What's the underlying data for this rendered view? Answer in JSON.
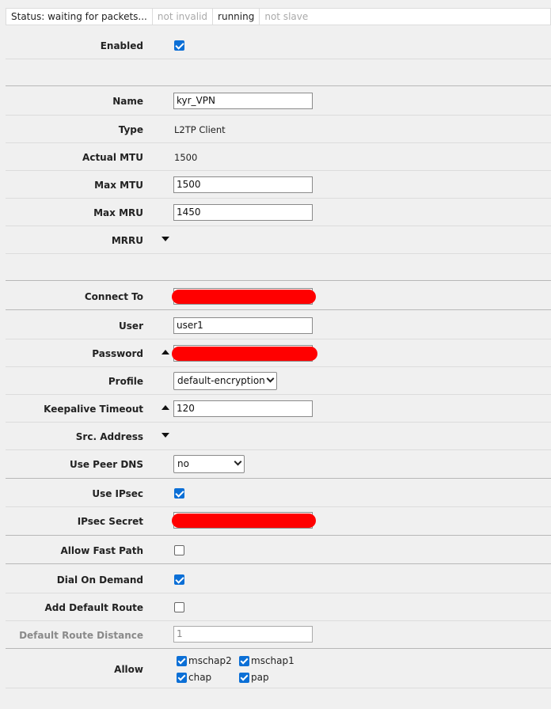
{
  "status": {
    "items": [
      {
        "text": "Status: waiting for packets...",
        "active": true
      },
      {
        "text": "not invalid",
        "active": false
      },
      {
        "text": "running",
        "active": true
      },
      {
        "text": "not slave",
        "active": false
      }
    ]
  },
  "general": {
    "enabled_label": "Enabled",
    "enabled": true
  },
  "interface": {
    "name_label": "Name",
    "name_value": "kyr_VPN",
    "type_label": "Type",
    "type_value": "L2TP Client",
    "actual_mtu_label": "Actual MTU",
    "actual_mtu_value": "1500",
    "max_mtu_label": "Max MTU",
    "max_mtu_value": "1500",
    "max_mru_label": "Max MRU",
    "max_mru_value": "1450",
    "mrru_label": "MRRU"
  },
  "dialout": {
    "connect_to_label": "Connect To",
    "user_label": "User",
    "user_value": "user1",
    "password_label": "Password",
    "profile_label": "Profile",
    "profile_value": "default-encryption",
    "keepalive_label": "Keepalive Timeout",
    "keepalive_value": "120",
    "src_address_label": "Src. Address",
    "use_peer_dns_label": "Use Peer DNS",
    "use_peer_dns_value": "no",
    "use_ipsec_label": "Use IPsec",
    "use_ipsec": true,
    "ipsec_secret_label": "IPsec Secret",
    "allow_fast_path_label": "Allow Fast Path",
    "allow_fast_path": false,
    "dial_on_demand_label": "Dial On Demand",
    "dial_on_demand": true,
    "add_default_route_label": "Add Default Route",
    "add_default_route": false,
    "default_route_distance_label": "Default Route Distance",
    "default_route_distance_value": "1",
    "allow_label": "Allow",
    "allow": {
      "mschap2": "mschap2",
      "mschap1": "mschap1",
      "chap": "chap",
      "pap": "pap"
    }
  },
  "colors": {
    "checkbox": "#0b6fd6",
    "redaction": "#ff0000"
  }
}
